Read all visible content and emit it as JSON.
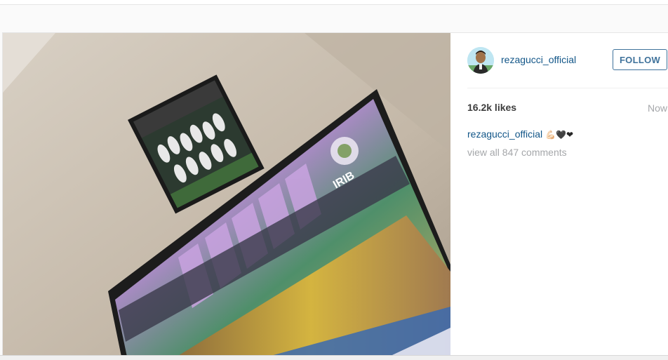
{
  "post": {
    "photo_alt": "",
    "tv_logo_text": "IRIB"
  },
  "header": {
    "username": "rezagucci_official",
    "follow_label": "FOLLOW"
  },
  "stats": {
    "likes": "16.2k likes",
    "time": "Now"
  },
  "caption": {
    "username": "rezagucci_official",
    "text": "💪🏻🖤❤"
  },
  "comments": {
    "view_all": "view all 847 comments"
  },
  "colors": {
    "link_blue": "#125688",
    "follow_blue": "#3f729b",
    "muted_gray": "#a5a7aa"
  }
}
